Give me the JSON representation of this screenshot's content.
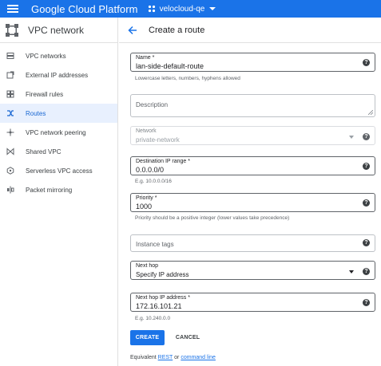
{
  "topbar": {
    "brand": "Google Cloud Platform",
    "project": "velocloud-qe"
  },
  "sidebar": {
    "title": "VPC network",
    "items": [
      {
        "label": "VPC networks",
        "icon": "vpc-networks-icon"
      },
      {
        "label": "External IP addresses",
        "icon": "external-ip-icon"
      },
      {
        "label": "Firewall rules",
        "icon": "firewall-icon"
      },
      {
        "label": "Routes",
        "icon": "routes-icon",
        "active": true
      },
      {
        "label": "VPC network peering",
        "icon": "peering-icon"
      },
      {
        "label": "Shared VPC",
        "icon": "shared-vpc-icon"
      },
      {
        "label": "Serverless VPC access",
        "icon": "serverless-icon"
      },
      {
        "label": "Packet mirroring",
        "icon": "packet-mirroring-icon"
      }
    ]
  },
  "page": {
    "title": "Create a route"
  },
  "form": {
    "name": {
      "label": "Name *",
      "value": "lan-side-default-route",
      "hint": "Lowercase letters, numbers, hyphens allowed"
    },
    "description": {
      "placeholder": "Description"
    },
    "network": {
      "label": "Network",
      "value": "private-network"
    },
    "destination": {
      "label": "Destination IP range *",
      "value": "0.0.0.0/0",
      "hint": "E.g. 10.0.0.0/16"
    },
    "priority": {
      "label": "Priority *",
      "value": "1000",
      "hint": "Priority should be a positive integer (lower values take precedence)"
    },
    "instance_tags": {
      "placeholder": "Instance tags"
    },
    "next_hop": {
      "label": "Next hop",
      "value": "Specify IP address"
    },
    "next_hop_ip": {
      "label": "Next hop IP address *",
      "value": "172.16.101.21",
      "hint": "E.g. 10.240.0.0"
    }
  },
  "actions": {
    "create": "CREATE",
    "cancel": "CANCEL"
  },
  "footer": {
    "prefix": "Equivalent",
    "rest": "REST",
    "or": "or",
    "command_line": "command line"
  },
  "colors": {
    "accent": "#1a73e8",
    "active_bg": "#e8f0fe"
  }
}
